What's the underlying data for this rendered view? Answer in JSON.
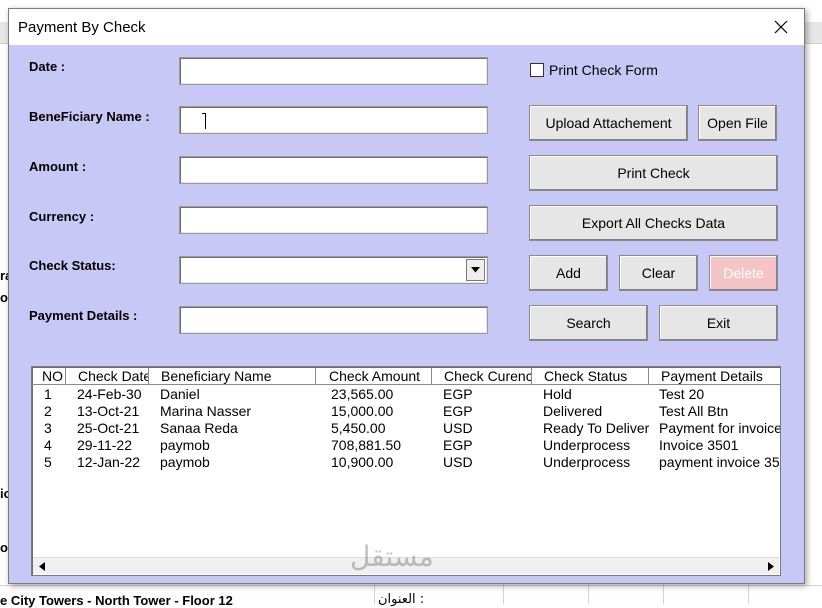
{
  "background_sheet": {
    "visible_texts": [
      "ra",
      "o",
      "ic",
      "o",
      "e City Towers - North Tower - Floor 12",
      "العنوان :"
    ]
  },
  "dialog": {
    "title": "Payment By Check",
    "fields": {
      "date_label": "Date :",
      "beneficiary_label": "BeneFiciary Name  :",
      "amount_label": "Amount :",
      "currency_label": "Currency :",
      "check_status_label": "Check Status:",
      "payment_details_label": "Payment Details :"
    },
    "values": {
      "date": "",
      "beneficiary": "",
      "amount": "",
      "currency": "",
      "check_status": "",
      "payment_details": ""
    },
    "print_check_form_label": "Print Check Form",
    "print_check_form_checked": false,
    "buttons": {
      "upload": "Upload Attachement",
      "open_file": "Open File",
      "print_check": "Print Check",
      "export": "Export All Checks Data",
      "add": "Add",
      "clear": "Clear",
      "delete": "Delete",
      "search": "Search",
      "exit": "Exit"
    },
    "table": {
      "columns": [
        "NO",
        "Check Date",
        "Beneficiary Name",
        "Check Amount",
        "Check Curency",
        "Check Status",
        "Payment Details"
      ],
      "rows": [
        [
          "1",
          "24-Feb-30",
          "Daniel",
          "23,565.00",
          "EGP",
          "Hold",
          "Test 20"
        ],
        [
          "2",
          "13-Oct-21",
          "Marina Nasser",
          "15,000.00",
          "EGP",
          "Delivered",
          "Test All Btn"
        ],
        [
          "3",
          "25-Oct-21",
          "Sanaa Reda",
          "5,450.00",
          "USD",
          "Ready To Deliver",
          "Payment for invoice"
        ],
        [
          "4",
          "29-11-22",
          "paymob",
          "708,881.50",
          "EGP",
          "Underprocess",
          "Invoice 3501"
        ],
        [
          "5",
          "12-Jan-22",
          "paymob",
          "10,900.00",
          "USD",
          "Underprocess",
          "payment invoice 35"
        ]
      ]
    }
  },
  "watermark_text": "مستقل",
  "colors": {
    "dialog_bg": "#c8c8f6",
    "delete_disabled_bg": "#f4c4c6"
  }
}
